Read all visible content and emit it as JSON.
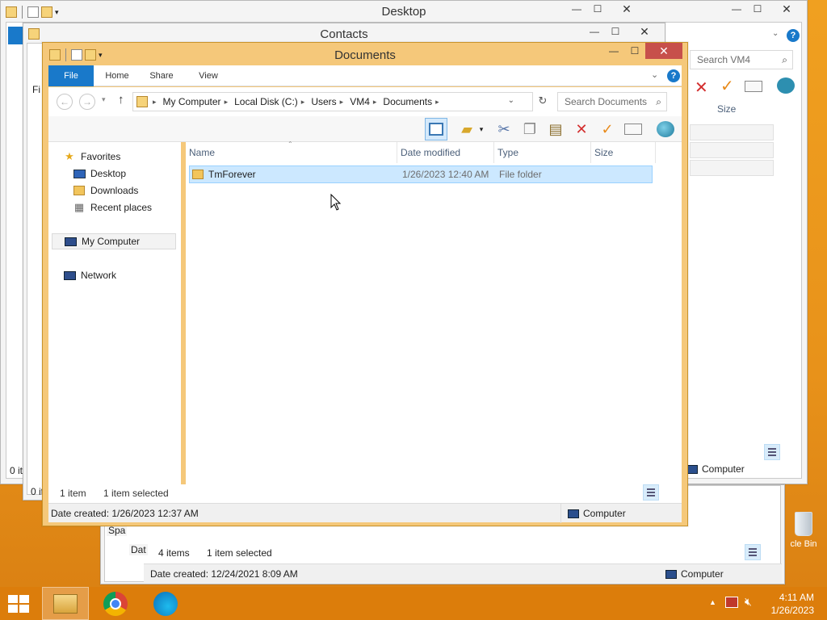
{
  "desktop": {
    "recycle_label": "cle Bin"
  },
  "desktop_window": {
    "title": "Desktop",
    "search_placeholder": "Search VM4",
    "col_size": "Size",
    "status_computer": "Computer",
    "status_items": "0 it",
    "status_items2": "0 it"
  },
  "contacts_window": {
    "title": "Contacts",
    "status_items": "4 items",
    "status_selected": "1 item selected",
    "date_created": "Date created: 12/24/2021 8:09 AM",
    "computer": "Computer",
    "frag_spa": "Spa",
    "frag_dat": "Dat",
    "frag_f": "Fi"
  },
  "documents_window": {
    "title": "Documents",
    "tabs": [
      "File",
      "Home",
      "Share",
      "View"
    ],
    "breadcrumb": [
      "My Computer",
      "Local Disk (C:)",
      "Users",
      "VM4",
      "Documents"
    ],
    "search_placeholder": "Search Documents",
    "nav": {
      "favorites": "Favorites",
      "desktop": "Desktop",
      "downloads": "Downloads",
      "recent": "Recent places",
      "mycomputer": "My Computer",
      "network": "Network"
    },
    "columns": {
      "name": "Name",
      "date": "Date modified",
      "type": "Type",
      "size": "Size"
    },
    "files": [
      {
        "name": "TmForever",
        "date": "1/26/2023 12:40 AM",
        "type": "File folder",
        "size": ""
      }
    ],
    "status_items": "1 item",
    "status_selected": "1 item selected",
    "date_created": "Date created: 1/26/2023 12:37 AM",
    "computer": "Computer"
  },
  "taskbar": {
    "time": "4:11 AM",
    "date": "1/26/2023"
  },
  "colors": {
    "accent": "#1979ca",
    "frame_active": "#f5c87a",
    "selection": "#cce8ff"
  }
}
